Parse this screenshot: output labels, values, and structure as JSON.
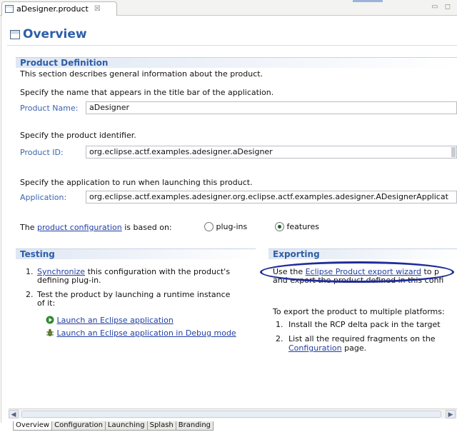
{
  "tab": {
    "label": "aDesigner.product",
    "close": "☒",
    "window_controls": "▭ ◻"
  },
  "page_title": "Overview",
  "product_definition": {
    "title": "Product Definition",
    "description": "This section describes general information about the product.",
    "name_hint": "Specify the name that appears in the title bar of the application.",
    "name_label": "Product Name:",
    "name_value": "aDesigner",
    "id_hint": "Specify the product identifier.",
    "id_label": "Product ID:",
    "id_value": "org.eclipse.actf.examples.adesigner.aDesigner",
    "app_hint": "Specify the application to run when launching this product.",
    "app_label": "Application:",
    "app_value": "org.eclipse.actf.examples.adesigner.org.eclipse.actf.examples.adesigner.ADesignerApplicat",
    "config_prefix": "The",
    "config_link": "product configuration",
    "config_suffix": "is based on:",
    "option_plugins": "plug-ins",
    "option_features": "features"
  },
  "testing": {
    "title": "Testing",
    "item1_num": "1.",
    "item1_link": "Synchronize",
    "item1_text_a": "this configuration with the product's",
    "item1_text_b": "defining plug-in.",
    "item2_num": "2.",
    "item2_text_a": "Test the product by launching a runtime instance",
    "item2_text_b": "of it:",
    "launch_link": "Launch an Eclipse application",
    "debug_link": "Launch an Eclipse application in Debug mode"
  },
  "exporting": {
    "title": "Exporting",
    "use_prefix": "Use the",
    "wizard_link": "Eclipse Product export wizard",
    "use_suffix": "to p",
    "line2": "and export the product defined in this confi",
    "multi_intro": "To export the product to multiple platforms:",
    "item1_num": "1.",
    "item1_text": "Install the RCP delta pack in the target",
    "item2_num": "2.",
    "item2_text": "List all the required fragments on the",
    "config_link": "Configuration",
    "page_word": "page."
  },
  "bottom_tabs": [
    "Overview",
    "Configuration",
    "Launching",
    "Splash",
    "Branding"
  ]
}
